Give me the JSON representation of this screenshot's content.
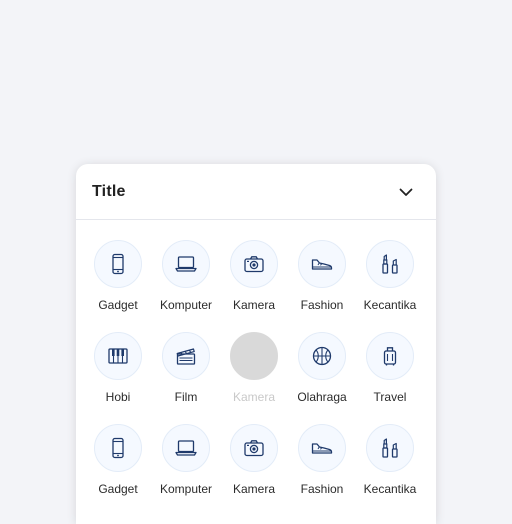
{
  "panel": {
    "title": "Title",
    "collapse_icon": "chevron-down-icon"
  },
  "colors": {
    "icon_stroke": "#1f3a6b",
    "circle_bg": "#f5f9ff",
    "disabled_circle": "#d9d9d9",
    "disabled_label": "#c9c9c9"
  },
  "rows": [
    {
      "items": [
        {
          "label": "Gadget",
          "icon": "smartphone-icon",
          "disabled": false
        },
        {
          "label": "Komputer",
          "icon": "laptop-icon",
          "disabled": false
        },
        {
          "label": "Kamera",
          "icon": "camera-icon",
          "disabled": false
        },
        {
          "label": "Fashion",
          "icon": "sneaker-icon",
          "disabled": false
        },
        {
          "label": "Kecantika",
          "icon": "cosmetics-icon",
          "disabled": false
        }
      ]
    },
    {
      "items": [
        {
          "label": "Hobi",
          "icon": "piano-icon",
          "disabled": false
        },
        {
          "label": "Film",
          "icon": "clapperboard-icon",
          "disabled": false
        },
        {
          "label": "Kamera",
          "icon": "placeholder-icon",
          "disabled": true
        },
        {
          "label": "Olahraga",
          "icon": "basketball-icon",
          "disabled": false
        },
        {
          "label": "Travel",
          "icon": "luggage-icon",
          "disabled": false
        }
      ]
    },
    {
      "items": [
        {
          "label": "Gadget",
          "icon": "smartphone-icon",
          "disabled": false
        },
        {
          "label": "Komputer",
          "icon": "laptop-icon",
          "disabled": false
        },
        {
          "label": "Kamera",
          "icon": "camera-icon",
          "disabled": false
        },
        {
          "label": "Fashion",
          "icon": "sneaker-icon",
          "disabled": false
        },
        {
          "label": "Kecantika",
          "icon": "cosmetics-icon",
          "disabled": false
        }
      ]
    }
  ]
}
